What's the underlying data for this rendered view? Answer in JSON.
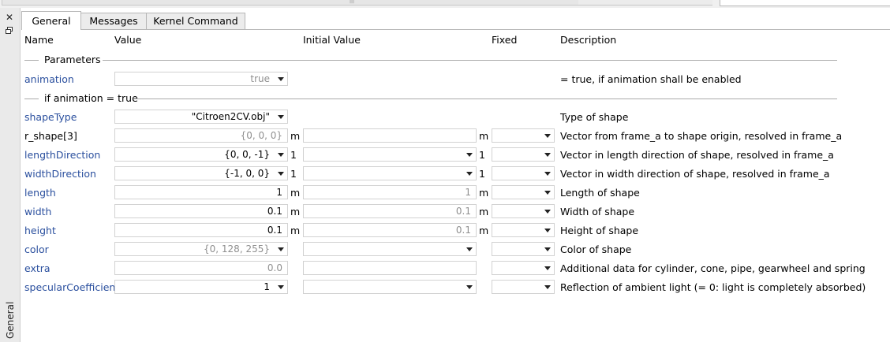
{
  "tabs": [
    "General",
    "Messages",
    "Kernel Command"
  ],
  "side": {
    "close_glyph": "✕",
    "vertical_label": "General"
  },
  "columns": {
    "name": "Name",
    "value": "Value",
    "initial": "Initial Value",
    "fixed": "Fixed",
    "description": "Description"
  },
  "groups": {
    "parameters": "Parameters",
    "if_animation": "if animation = true"
  },
  "rows": {
    "animation": {
      "name": "animation",
      "value": "true",
      "description": "= true, if animation shall be enabled"
    },
    "shapeType": {
      "name": "shapeType",
      "value": "\"Citroen2CV.obj\"",
      "description": "Type of shape"
    },
    "r_shape": {
      "name": "r_shape",
      "suffix": "[3]",
      "value": "{0, 0, 0}",
      "unit": "m",
      "initial_unit": "m",
      "description": "Vector from frame_a to shape origin, resolved in frame_a"
    },
    "lengthDirection": {
      "name": "lengthDirection",
      "value": "{0, 0, -1}",
      "unit": "1",
      "initial_unit": "1",
      "description": "Vector in length direction of shape, resolved in frame_a"
    },
    "widthDirection": {
      "name": "widthDirection",
      "value": "{-1, 0, 0}",
      "unit": "1",
      "initial_unit": "1",
      "description": "Vector in width direction of shape, resolved in frame_a"
    },
    "length": {
      "name": "length",
      "value": "1",
      "unit": "m",
      "initial": "1",
      "initial_unit": "m",
      "description": "Length of shape"
    },
    "width": {
      "name": "width",
      "value": "0.1",
      "unit": "m",
      "initial": "0.1",
      "initial_unit": "m",
      "description": "Width of shape"
    },
    "height": {
      "name": "height",
      "value": "0.1",
      "unit": "m",
      "initial": "0.1",
      "initial_unit": "m",
      "description": "Height of shape"
    },
    "color": {
      "name": "color",
      "value": "{0, 128, 255}",
      "description": "Color of shape"
    },
    "extra": {
      "name": "extra",
      "value": "0.0",
      "description": "Additional data for cylinder, cone, pipe, gearwheel and spring"
    },
    "specularCoefficient": {
      "name": "specularCoefficient",
      "value": "1",
      "description": "Reflection of ambient light (= 0: light is completely absorbed)"
    }
  },
  "colors": {
    "param_name": "#2a4f9e",
    "grey_value": "#909090",
    "group_line": "#aaaaaa"
  },
  "icons": [
    "close-icon",
    "float-window-icon",
    "dropdown-arrow-icon"
  ]
}
